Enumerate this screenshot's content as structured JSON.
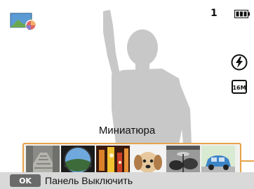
{
  "status": {
    "shot_count": "1",
    "battery_icon": "battery-full-icon",
    "mode_icon": "photo-mode-icon",
    "flash_icon": "flash-auto-icon",
    "resolution_icon": "resolution-16m-icon"
  },
  "mode": {
    "label": "Миниатюра"
  },
  "thumbnails": [
    {
      "icon": "thumbnail-stairs"
    },
    {
      "icon": "thumbnail-fisheye"
    },
    {
      "icon": "thumbnail-city-lights"
    },
    {
      "icon": "thumbnail-puppy"
    },
    {
      "icon": "thumbnail-drums"
    },
    {
      "icon": "thumbnail-blue-car"
    }
  ],
  "bottom_bar": {
    "ok_key": "OK",
    "hint": "Панель Выключить"
  },
  "colors": {
    "highlight": "#e8a24a",
    "silhouette": "#c8c8c8",
    "bar": "#d9d9d9"
  }
}
